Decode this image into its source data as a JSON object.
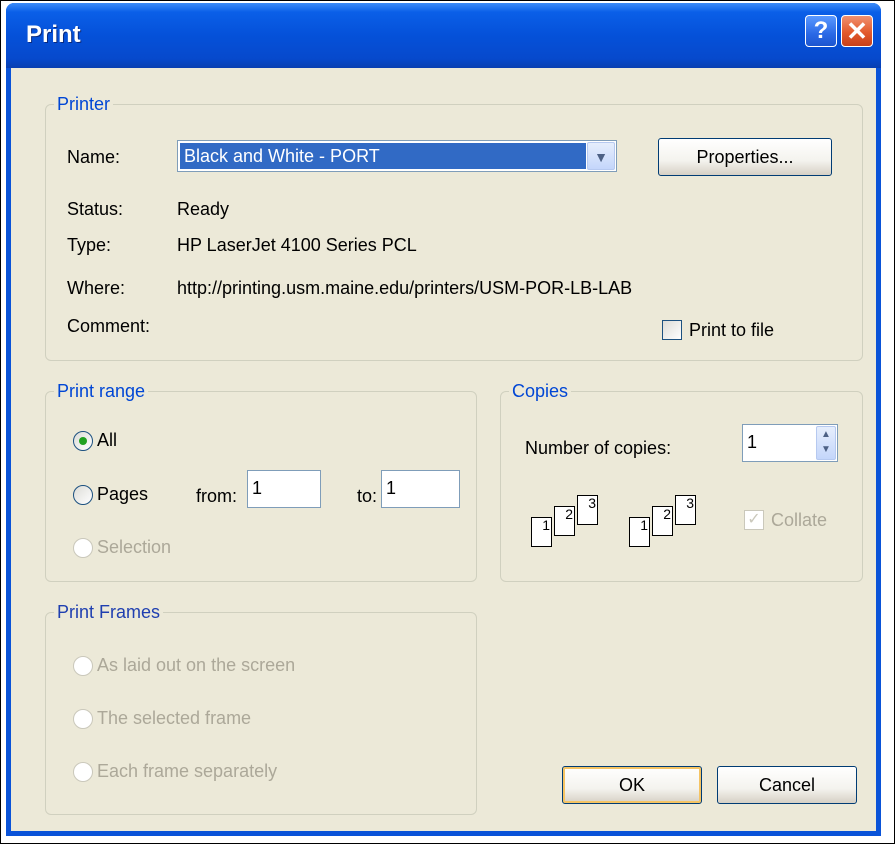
{
  "dialog": {
    "title": "Print",
    "help_glyph": "?",
    "close_glyph": "✕"
  },
  "printer": {
    "legend": "Printer",
    "name_label": "Name:",
    "name_value": "Black and White - PORT",
    "properties_label": "Properties...",
    "status_label": "Status:",
    "status_value": "Ready",
    "type_label": "Type:",
    "type_value": "HP LaserJet 4100 Series PCL",
    "where_label": "Where:",
    "where_value": "http://printing.usm.maine.edu/printers/USM-POR-LB-LAB",
    "comment_label": "Comment:",
    "print_to_file_label": "Print to file"
  },
  "print_range": {
    "legend": "Print range",
    "all_label": "All",
    "pages_label": "Pages",
    "from_label": "from:",
    "from_value": "1",
    "to_label": "to:",
    "to_value": "1",
    "selection_label": "Selection"
  },
  "copies": {
    "legend": "Copies",
    "number_label": "Number of copies:",
    "number_value": "1",
    "collate_label": "Collate",
    "page_numbers": [
      "1",
      "2",
      "3"
    ]
  },
  "print_frames": {
    "legend": "Print Frames",
    "options": [
      "As laid out on the screen",
      "The selected frame",
      "Each frame separately"
    ]
  },
  "buttons": {
    "ok_label": "OK",
    "cancel_label": "Cancel"
  },
  "colors": {
    "titlebar": "#0551d9",
    "dialog_bg": "#ece9d8",
    "legend_text": "#0046d5",
    "disabled_text": "#aca899",
    "selection": "#316ac5"
  }
}
